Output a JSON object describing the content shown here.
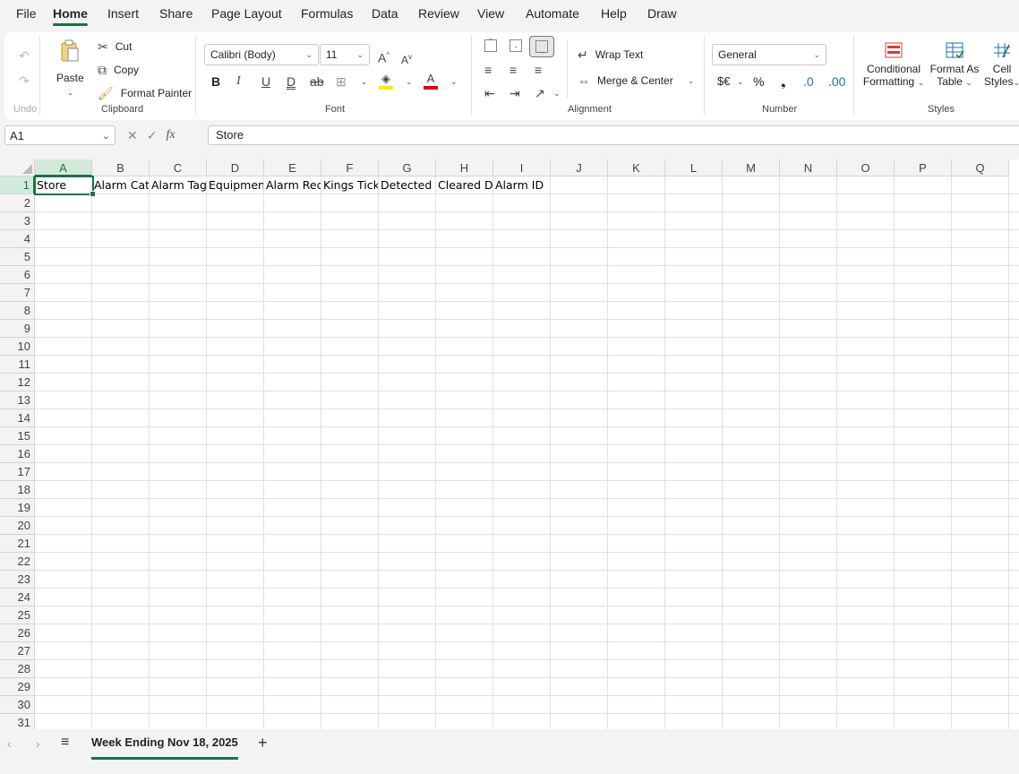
{
  "menu": {
    "tabs": [
      "File",
      "Home",
      "Insert",
      "Share",
      "Page Layout",
      "Formulas",
      "Data",
      "Review",
      "View",
      "Automate",
      "Help",
      "Draw"
    ],
    "active": "Home"
  },
  "ribbon": {
    "undo": {
      "undo_icon": "undo-arrow",
      "redo_icon": "redo-arrow",
      "group_label": "Undo"
    },
    "clipboard": {
      "paste_label": "Paste",
      "cut_label": "Cut",
      "copy_label": "Copy",
      "format_painter_label": "Format Painter",
      "group_label": "Clipboard"
    },
    "font": {
      "font_name": "Calibri (Body)",
      "font_size": "11",
      "bold": "B",
      "italic": "I",
      "underline": "U",
      "double_underline": "D",
      "strikethrough": "ab",
      "fill_color": "#ffe600",
      "font_color": "#e00000",
      "group_label": "Font"
    },
    "alignment": {
      "wrap_text_label": "Wrap Text",
      "merge_center_label": "Merge & Center",
      "group_label": "Alignment"
    },
    "number": {
      "format": "General",
      "currency_symbol": "$€",
      "percent_symbol": "%",
      "comma_symbol": "❟",
      "group_label": "Number"
    },
    "styles": {
      "conditional_formatting_line1": "Conditional",
      "conditional_formatting_line2": "Formatting",
      "format_as_table_line1": "Format As",
      "format_as_table_line2": "Table",
      "cell_styles_line1": "Cell",
      "cell_styles_line2": "Styles",
      "group_label": "Styles"
    }
  },
  "formula_bar": {
    "name_box": "A1",
    "fx": "fx",
    "content": "Store"
  },
  "grid": {
    "columns": [
      "A",
      "B",
      "C",
      "D",
      "E",
      "F",
      "G",
      "H",
      "I",
      "J",
      "K",
      "L",
      "M",
      "N",
      "O",
      "P",
      "Q"
    ],
    "rows": [
      "1",
      "2",
      "3",
      "4",
      "5",
      "6",
      "7",
      "8",
      "9",
      "10",
      "11",
      "12",
      "13",
      "14",
      "15",
      "16",
      "17",
      "18",
      "19",
      "20",
      "21",
      "22",
      "23",
      "24",
      "25",
      "26",
      "27",
      "28",
      "29",
      "30",
      "31"
    ],
    "row1": [
      "Store",
      "Alarm Category",
      "Alarm Tag",
      "Equipment",
      "Alarm Received",
      "Kings Ticket",
      "Detected Date",
      "Cleared Date",
      "Alarm ID"
    ],
    "selected_cell": "A1"
  },
  "sheets": {
    "tabs": [
      "Week Ending Nov 18, 2025"
    ],
    "add_icon": "+"
  },
  "colors": {
    "accent": "#1f7145",
    "selection": "#d2eadb"
  }
}
